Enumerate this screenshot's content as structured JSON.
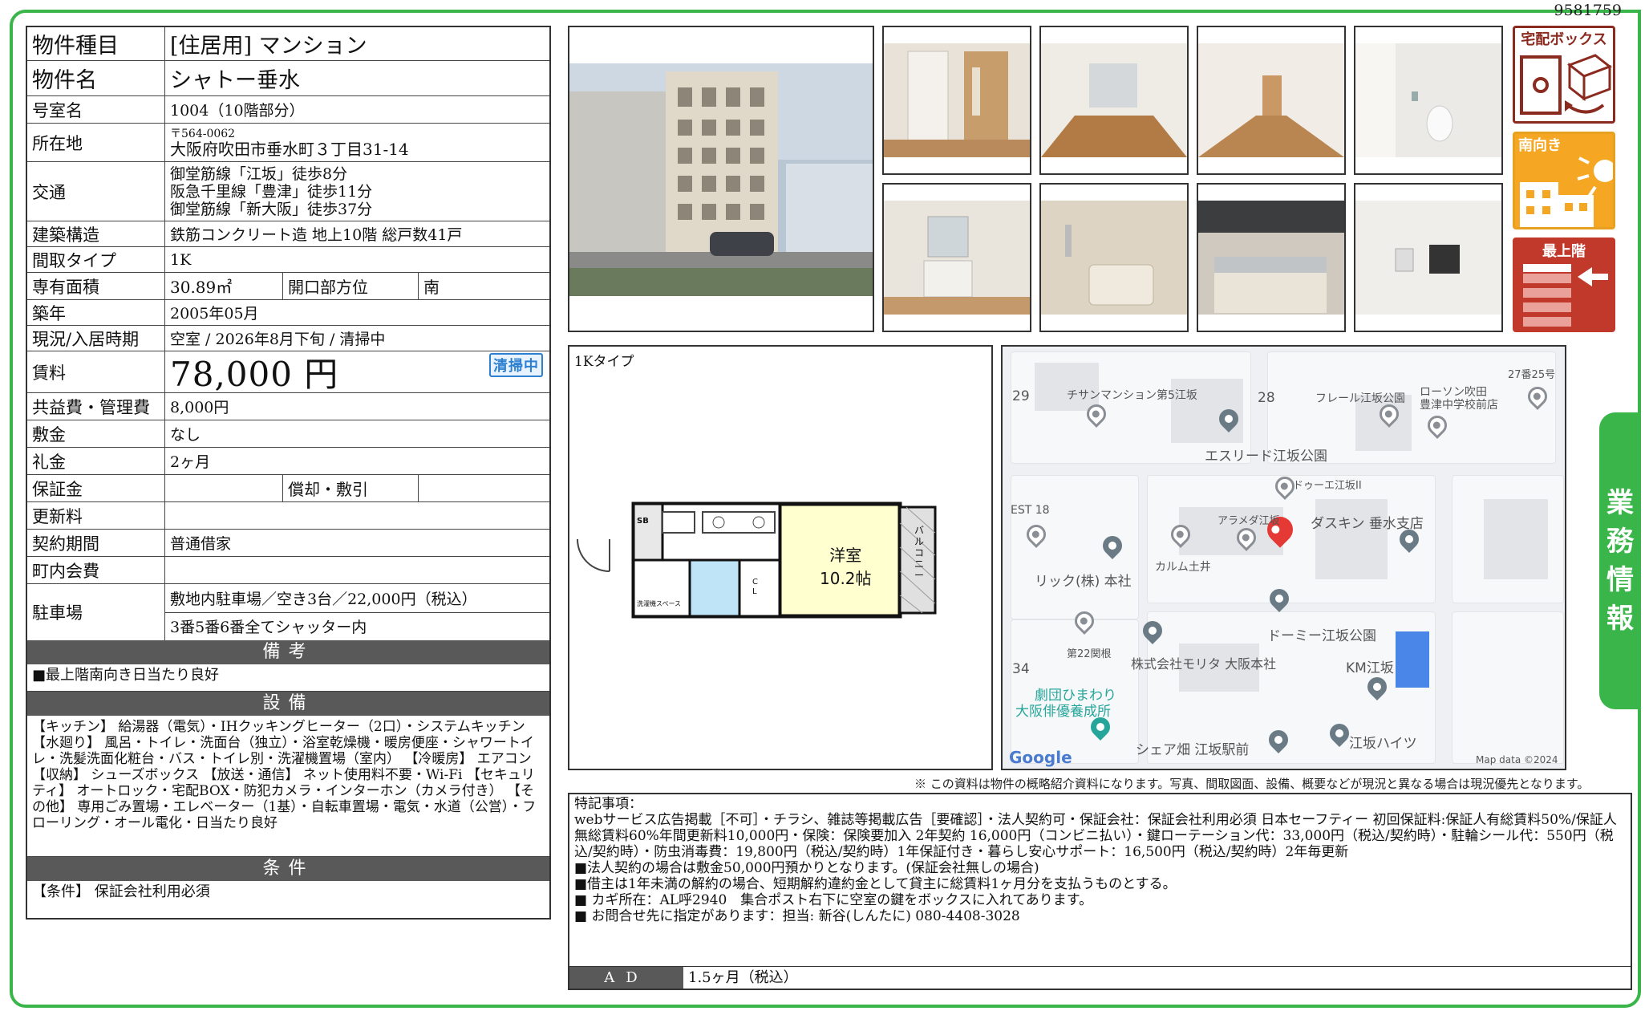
{
  "doc_id": "9581759",
  "property": {
    "type_label": "物件種目",
    "type_value": "[住居用]  マンション",
    "name_label": "物件名",
    "name_value": "シャトー垂水",
    "room_label": "号室名",
    "room_value": "1004（10階部分）",
    "address_label": "所在地",
    "postal": "〒564-0062",
    "address": "大阪府吹田市垂水町３丁目31-14",
    "transport_label": "交通",
    "transport": [
      "御堂筋線「江坂」徒歩8分",
      "阪急千里線「豊津」徒歩11分",
      "御堂筋線「新大阪」徒歩37分"
    ],
    "structure_label": "建築構造",
    "structure_value": "鉄筋コンクリート造 地上10階 総戸数41戸",
    "layout_label": "間取タイプ",
    "layout_value": "1K",
    "area_label": "専有面積",
    "area_value": "30.89㎡",
    "direction_label": "開口部方位",
    "direction_value": "南",
    "built_label": "築年",
    "built_value": "2005年05月",
    "status_label": "現況/入居時期",
    "status_value": "空室 / 2026年8月下旬 / 清掃中",
    "rent_label": "賃料",
    "rent_value": "78,000 円",
    "cleaning_badge": "清掃中",
    "fee_label": "共益費・管理費",
    "fee_value": "8,000円",
    "deposit_label": "敷金",
    "deposit_value": "なし",
    "key_money_label": "礼金",
    "key_money_value": "2ヶ月",
    "guarantee_label": "保証金",
    "guarantee_value": "",
    "amort_label": "償却・敷引",
    "amort_value": "",
    "renewal_label": "更新料",
    "renewal_value": "",
    "contract_label": "契約期間",
    "contract_value": "普通借家",
    "community_label": "町内会費",
    "community_value": "",
    "parking_label": "駐車場",
    "parking_value1": "敷地内駐車場／空き3台／22,000円（税込）",
    "parking_value2": "3番5番6番全てシャッター内"
  },
  "sections": {
    "remarks_head": "備考",
    "remarks_body": "■最上階南向き日当たり良好",
    "equipment_head": "設備",
    "equipment_body": "【キッチン】 給湯器（電気）・IHクッキングヒーター（2口）・システムキッチン 【水廻り】 風呂・トイレ・洗面台（独立）・浴室乾燥機・暖房便座・シャワートイレ・洗髪洗面化粧台・バス・トイレ別・洗濯機置場（室内） 【冷暖房】 エアコン 【収納】 シューズボックス 【放送・通信】 ネット使用料不要・Wi-Fi 【セキュリティ】 オートロック・宅配BOX・防犯カメラ・インターホン（カメラ付き） 【その他】 専用ごみ置場・エレベーター（1基）・自転車置場・電気・水道（公営）・フローリング・オール電化・日当たり良好",
    "conditions_head": "条件",
    "conditions_body": "【条件】 保証会社利用必須"
  },
  "tags": {
    "delivery_box": "宅配ボックス",
    "south": "南向き",
    "top_floor": "最上階"
  },
  "floorplan": {
    "type_label": "1Kタイプ",
    "room": "洋室",
    "size": "10.2帖",
    "balcony": "バルコニー",
    "sb": "SB",
    "cl": "CL",
    "laundry": "洗濯機スペース"
  },
  "map": {
    "labels": [
      "29",
      "チサンマンション第5江坂",
      "28",
      "フレール江坂公園",
      "ローソン吹田",
      "豊津中学校前店",
      "27番25号",
      "エスリード江坂公園",
      "ドゥーエ江坂II",
      "EST 18",
      "アラメダ江坂",
      "ダスキン 垂水支店",
      "リック(株) 本社",
      "カルム土井",
      "ドーミー江坂公園",
      "第22関根",
      "株式会社モリタ 大阪本社",
      "KM江坂",
      "34",
      "劇団ひまわり",
      "大阪俳優養成所",
      "シェア畑 江坂駅前",
      "江坂ハイツ",
      "Google",
      "Map data ©2024"
    ]
  },
  "notice": "※ この資料は物件の概略紹介資料になります。写真、間取図面、設備、概要などが現況と異なる場合は現況優先となります。",
  "special": {
    "title": "特記事項：",
    "lines": [
      "webサービス広告掲載［不可］・チラシ、雑誌等掲載広告［要確認］・法人契約可・保証会社：保証会社利用必須 日本セーフティー 初回保証料:保証人有総賃料50%/保証人無総賃料60%年間更新料10,000円・保険：保険要加入 2年契約 16,000円（コンビニ払い）・鍵ローテーション代：33,000円（税込/契約時）・駐輪シール代：550円（税込/契約時）・防虫消毒費：19,800円（税込/契約時）1年保証付き・暮らし安心サポート：16,500円（税込/契約時）2年毎更新",
      "■法人契約の場合は敷金50,000円預かりとなります。(保証会社無しの場合)",
      "■借主は1年未満の解約の場合、短期解約違約金として貸主に総賃料1ヶ月分を支払うものとする。",
      "■ カギ所在：AL呼2940　集合ポスト右下に空室の鍵をボックスに入れてあります。",
      "■ お問合せ先に指定があります：担当: 新谷(しんたに) 080-4408-3028"
    ],
    "ad_label": "AD",
    "ad_value": "1.5ヶ月（税込）"
  },
  "side_tab": [
    "業",
    "務",
    "情",
    "報"
  ]
}
